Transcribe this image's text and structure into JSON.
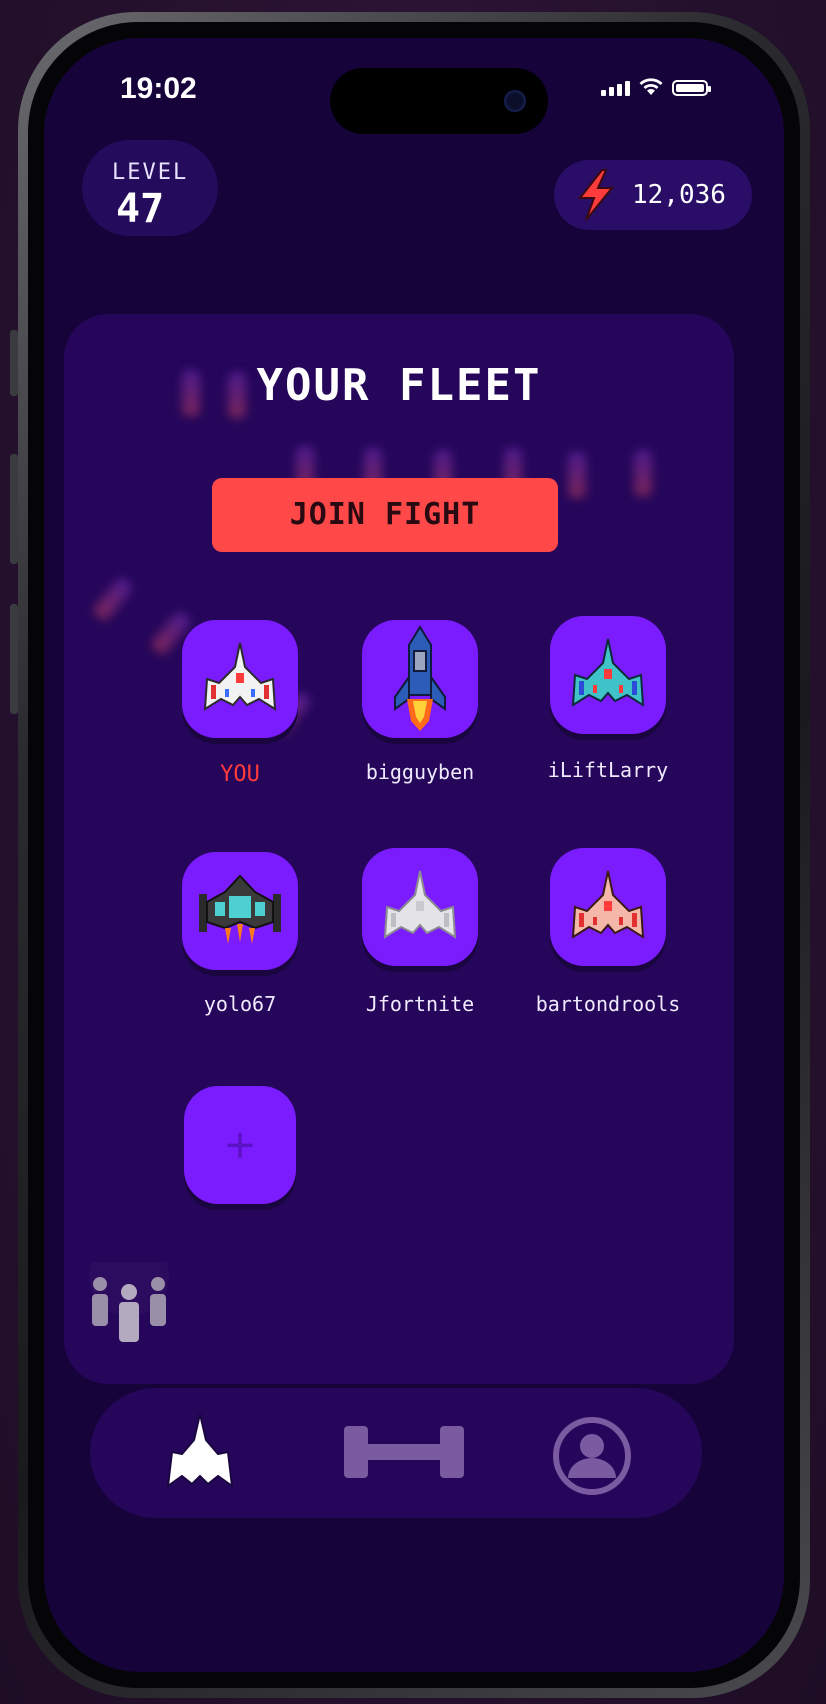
{
  "status_bar": {
    "time": "19:02"
  },
  "header": {
    "level_label": "LEVEL",
    "level_value": "47",
    "energy_value": "12,036",
    "accent_energy": "#ff3b3b"
  },
  "fleet": {
    "title": "YOUR FLEET",
    "join_button": "JOIN FIGHT",
    "members": [
      {
        "name": "YOU",
        "icon": "white-jet-ship-icon",
        "highlight": true
      },
      {
        "name": "bigguyben",
        "icon": "blue-rocket-ship-icon"
      },
      {
        "name": "iLiftLarry",
        "icon": "teal-jet-ship-icon"
      },
      {
        "name": "yolo67",
        "icon": "teal-fighter-ship-icon"
      },
      {
        "name": "Jfortnite",
        "icon": "grey-jet-ship-icon"
      },
      {
        "name": "bartondrools",
        "icon": "pink-jet-ship-icon"
      }
    ],
    "add_label": "+"
  },
  "nav": {
    "items": [
      {
        "icon": "ship-icon",
        "active": true
      },
      {
        "icon": "dumbbell-icon",
        "active": false
      },
      {
        "icon": "profile-icon",
        "active": false
      }
    ]
  },
  "colors": {
    "tile": "#7b1cff",
    "join_button": "#ff4949",
    "card": "#25065a",
    "screen": "#15033a"
  }
}
